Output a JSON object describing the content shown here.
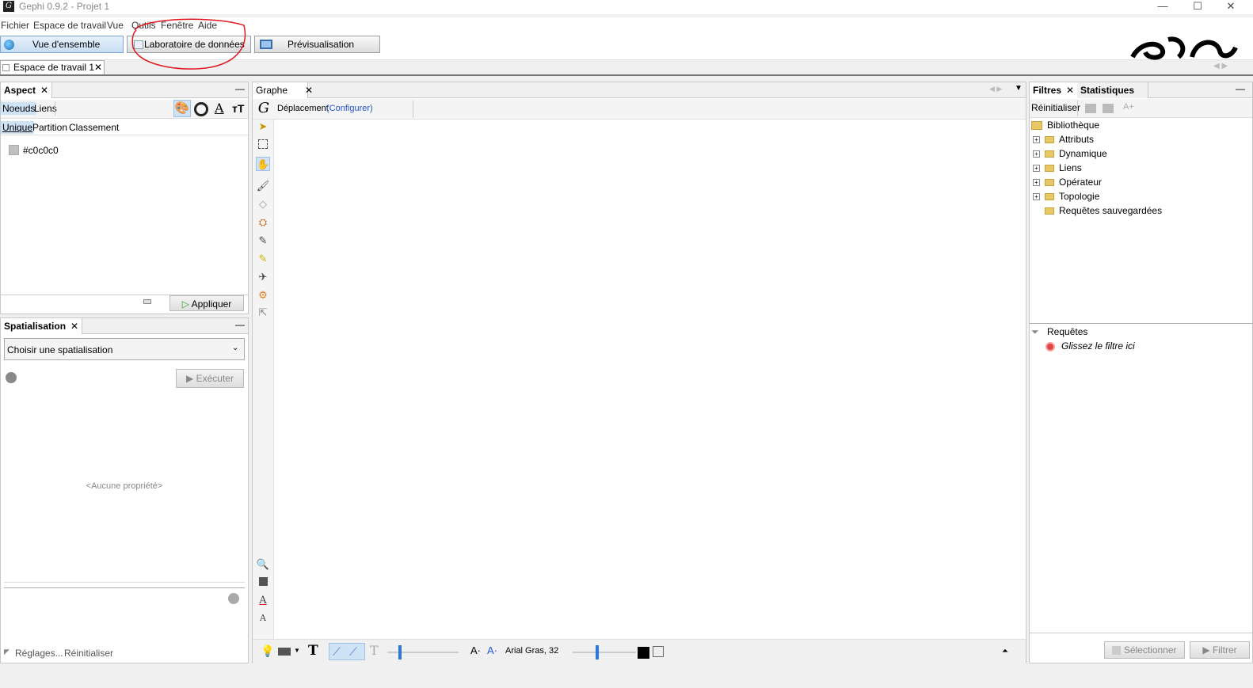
{
  "window": {
    "title": "Gephi 0.9.2 - Projet 1",
    "app_icon_glyph": "G",
    "minimize": "—",
    "maximize": "☐",
    "close": "✕"
  },
  "menu": [
    "Fichier",
    "Espace de travail",
    "Vue",
    "Outils",
    "Fenêtre",
    "Aide"
  ],
  "toolbar": {
    "overview": "Vue d'ensemble",
    "data_lab": "Laboratoire de données",
    "preview": "Prévisualisation"
  },
  "workspace_tab": {
    "label": "Espace de travail 1",
    "close": "✕"
  },
  "aspect_panel": {
    "title": "Aspect",
    "close": "✕",
    "minimize": "—",
    "subtabs": [
      "Noeuds",
      "Liens"
    ],
    "modes": [
      "Unique",
      "Partition",
      "Classement"
    ],
    "color_value": "#c0c0c0",
    "apply": "Appliquer"
  },
  "layout_panel": {
    "title": "Spatialisation",
    "close": "✕",
    "minimize": "—",
    "select": "Choisir une spatialisation",
    "run": "Exécuter",
    "no_property": "<Aucune propriété>",
    "settings": "Réglages...",
    "reset": "Réinitialiser"
  },
  "graph_panel": {
    "title": "Graphe",
    "close": "✕",
    "mode": "Déplacement",
    "configure": "(Configurer)",
    "font": "Arial Gras, 32"
  },
  "filters_panel": {
    "tab_filters": "Filtres",
    "tab_stats": "Statistiques",
    "close": "✕",
    "reset": "Réinitialiser",
    "library": "Bibliothèque",
    "library_items": [
      "Attributs",
      "Dynamique",
      "Liens",
      "Opérateur",
      "Topologie",
      "Requêtes sauvegardées"
    ],
    "queries": "Requêtes",
    "drop_hint": "Glissez le filtre ici",
    "select": "Sélectionner",
    "filter": "Filtrer"
  },
  "colors": {
    "annotation": "#e0191f",
    "selected": "#cfe3f7",
    "link": "#2255cc"
  }
}
